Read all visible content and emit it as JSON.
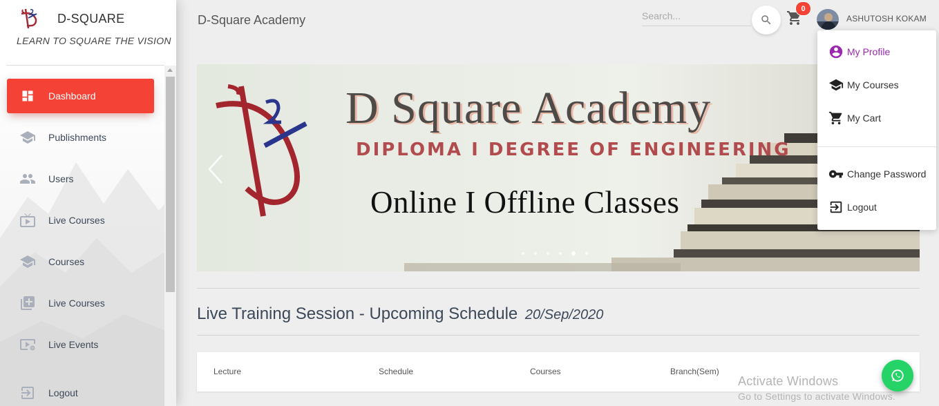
{
  "brand": {
    "name": "D-SQUARE",
    "tagline": "LEARN TO SQUARE THE VISION",
    "logo_icon": "d-square-logo"
  },
  "sidebar": {
    "items": [
      {
        "label": "Dashboard",
        "icon": "dashboard-icon",
        "active": true
      },
      {
        "label": "Publishments",
        "icon": "school-icon"
      },
      {
        "label": "Users",
        "icon": "people-icon"
      },
      {
        "label": "Live Courses",
        "icon": "live-tv-icon"
      },
      {
        "label": "Courses",
        "icon": "school-icon"
      },
      {
        "label": "Live Courses",
        "icon": "library-add-icon"
      },
      {
        "label": "Live Events",
        "icon": "video-settings-icon"
      },
      {
        "label": "Logout",
        "icon": "exit-icon"
      }
    ]
  },
  "header": {
    "title": "D-Square Academy",
    "search_placeholder": "Search...",
    "cart_count": "0",
    "user_name": "ASHUTOSH KOKAM"
  },
  "user_menu": {
    "items": [
      {
        "label": "My Profile",
        "icon": "account-circle-icon",
        "active": true
      },
      {
        "label": "My Courses",
        "icon": "school-icon"
      },
      {
        "label": "My Cart",
        "icon": "cart-icon"
      },
      {
        "label": "Change Password",
        "icon": "key-icon"
      },
      {
        "label": "Logout",
        "icon": "exit-icon"
      }
    ]
  },
  "banner": {
    "title": "D Square Academy",
    "subtitle": "DIPLOMA I DEGREE OF ENGINEERING",
    "tagline": "Online I Offline Classes",
    "slide_count": 6,
    "active_slide": 5
  },
  "schedule": {
    "title": "Live Training Session - Upcoming Schedule",
    "date": "20/Sep/2020",
    "columns": [
      "Lecture",
      "Schedule",
      "Courses",
      "Branch(Sem)"
    ]
  },
  "watermark": {
    "line1": "Activate Windows",
    "line2": "Go to Settings to activate Windows."
  },
  "colors": {
    "accent": "#f44336",
    "menu_active": "#9c27b0",
    "whatsapp": "#25d366"
  }
}
